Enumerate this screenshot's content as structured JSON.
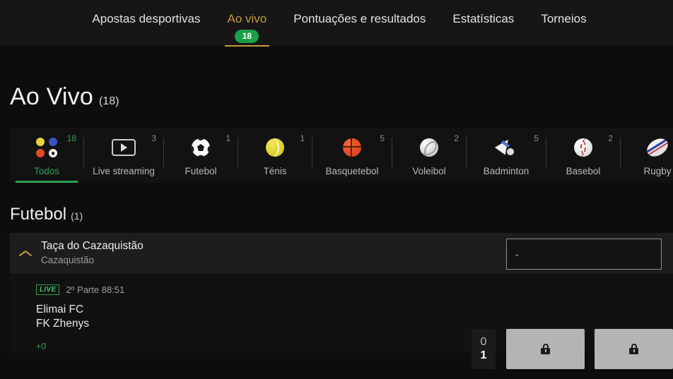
{
  "topnav": {
    "items": [
      {
        "label": "Apostas desportivas",
        "active": false,
        "badge": null
      },
      {
        "label": "Ao vivo",
        "active": true,
        "badge": "18"
      },
      {
        "label": "Pontuações e resultados",
        "active": false,
        "badge": null
      },
      {
        "label": "Estatísticas",
        "active": false,
        "badge": null
      },
      {
        "label": "Torneios",
        "active": false,
        "badge": null
      }
    ],
    "active_color": "#c49a3a",
    "badge_color": "#1a9e46"
  },
  "page": {
    "title": "Ao Vivo",
    "count": "(18)"
  },
  "sport_tabs": [
    {
      "label": "Todos",
      "count": "18",
      "icon": "all-sports-icon",
      "active": true
    },
    {
      "label": "Live streaming",
      "count": "3",
      "icon": "play-video-icon",
      "active": false
    },
    {
      "label": "Futebol",
      "count": "1",
      "icon": "soccer-ball-icon",
      "active": false
    },
    {
      "label": "Ténis",
      "count": "1",
      "icon": "tennis-ball-icon",
      "active": false
    },
    {
      "label": "Basquetebol",
      "count": "5",
      "icon": "basketball-icon",
      "active": false
    },
    {
      "label": "Voleibol",
      "count": "2",
      "icon": "volleyball-icon",
      "active": false
    },
    {
      "label": "Badminton",
      "count": "5",
      "icon": "shuttlecock-icon",
      "active": false
    },
    {
      "label": "Basebol",
      "count": "2",
      "icon": "baseball-icon",
      "active": false
    },
    {
      "label": "Rugby",
      "count": "",
      "icon": "rugby-ball-icon",
      "active": false
    }
  ],
  "sport_tabs_active_color": "#2f9e55",
  "section": {
    "title": "Futebol",
    "count": "(1)"
  },
  "league": {
    "name": "Taça do Cazaquistão",
    "country": "Cazaquistão",
    "collapse_icon": "chevron-up-icon",
    "market_placeholder": "-"
  },
  "match": {
    "live_label": "LIVE",
    "period": "2º Parte 88:51",
    "home_team": "Elimai FC",
    "away_team": "FK Zhenys",
    "more_markets": "+0",
    "home_score": "0",
    "away_score": "1",
    "odds": [
      {
        "locked": true,
        "icon": "lock-icon",
        "label": ""
      },
      {
        "locked": true,
        "icon": "lock-icon",
        "label": ""
      }
    ]
  }
}
